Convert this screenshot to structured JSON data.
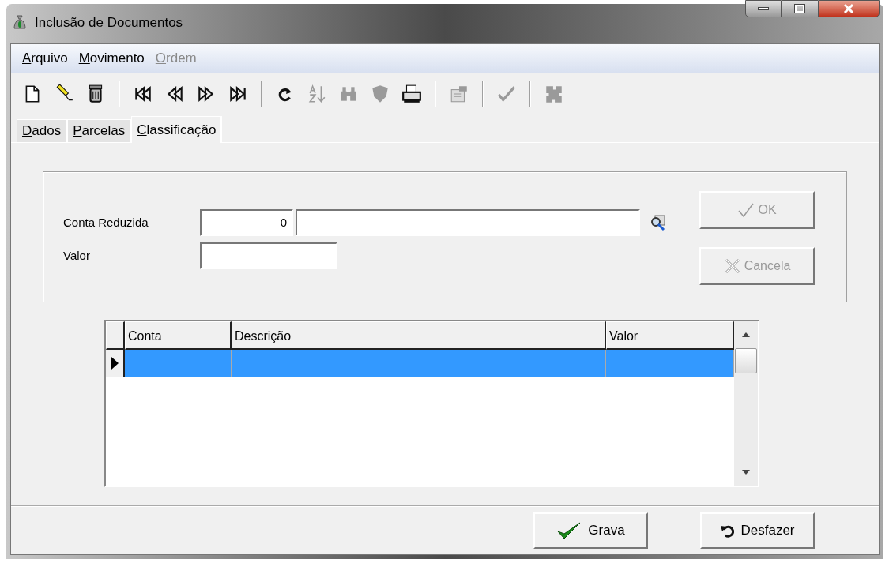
{
  "window": {
    "title": "Inclusão de Documentos"
  },
  "menu": [
    {
      "label": "Arquivo",
      "disabled": false
    },
    {
      "label": "Movimento",
      "disabled": false
    },
    {
      "label": "Ordem",
      "disabled": true
    }
  ],
  "toolbar": [
    {
      "kind": "new",
      "disabled": false
    },
    {
      "kind": "edit",
      "disabled": false
    },
    {
      "kind": "delete",
      "disabled": false
    },
    {
      "kind": "separator"
    },
    {
      "kind": "first",
      "disabled": false
    },
    {
      "kind": "prev",
      "disabled": false
    },
    {
      "kind": "next",
      "disabled": false
    },
    {
      "kind": "last",
      "disabled": false
    },
    {
      "kind": "separator"
    },
    {
      "kind": "refresh",
      "disabled": false
    },
    {
      "kind": "sort",
      "disabled": true
    },
    {
      "kind": "find",
      "disabled": true
    },
    {
      "kind": "stamp",
      "disabled": true
    },
    {
      "kind": "print",
      "disabled": false
    },
    {
      "kind": "separator"
    },
    {
      "kind": "form",
      "disabled": true
    },
    {
      "kind": "separator"
    },
    {
      "kind": "confirm",
      "disabled": true
    },
    {
      "kind": "separator"
    },
    {
      "kind": "puzzle",
      "disabled": true
    }
  ],
  "tabs": [
    {
      "label": "Dados",
      "selected": false
    },
    {
      "label": "Parcelas",
      "selected": false
    },
    {
      "label": "Classificação",
      "selected": true
    }
  ],
  "form": {
    "account_label": "Conta Reduzida",
    "account_code": "0",
    "value_label": "Valor",
    "buttons": [
      {
        "kind": "ok",
        "label": "OK",
        "disabled": true
      },
      {
        "kind": "cancel",
        "label": "Cancela",
        "disabled": true
      }
    ]
  },
  "table": {
    "columns": [
      "Conta",
      "Descrição",
      "Valor"
    ],
    "rows": [
      {
        "selected": true
      }
    ]
  },
  "footer_buttons": [
    {
      "kind": "save",
      "label": "Grava"
    },
    {
      "kind": "undo",
      "label": "Desfazer"
    }
  ]
}
